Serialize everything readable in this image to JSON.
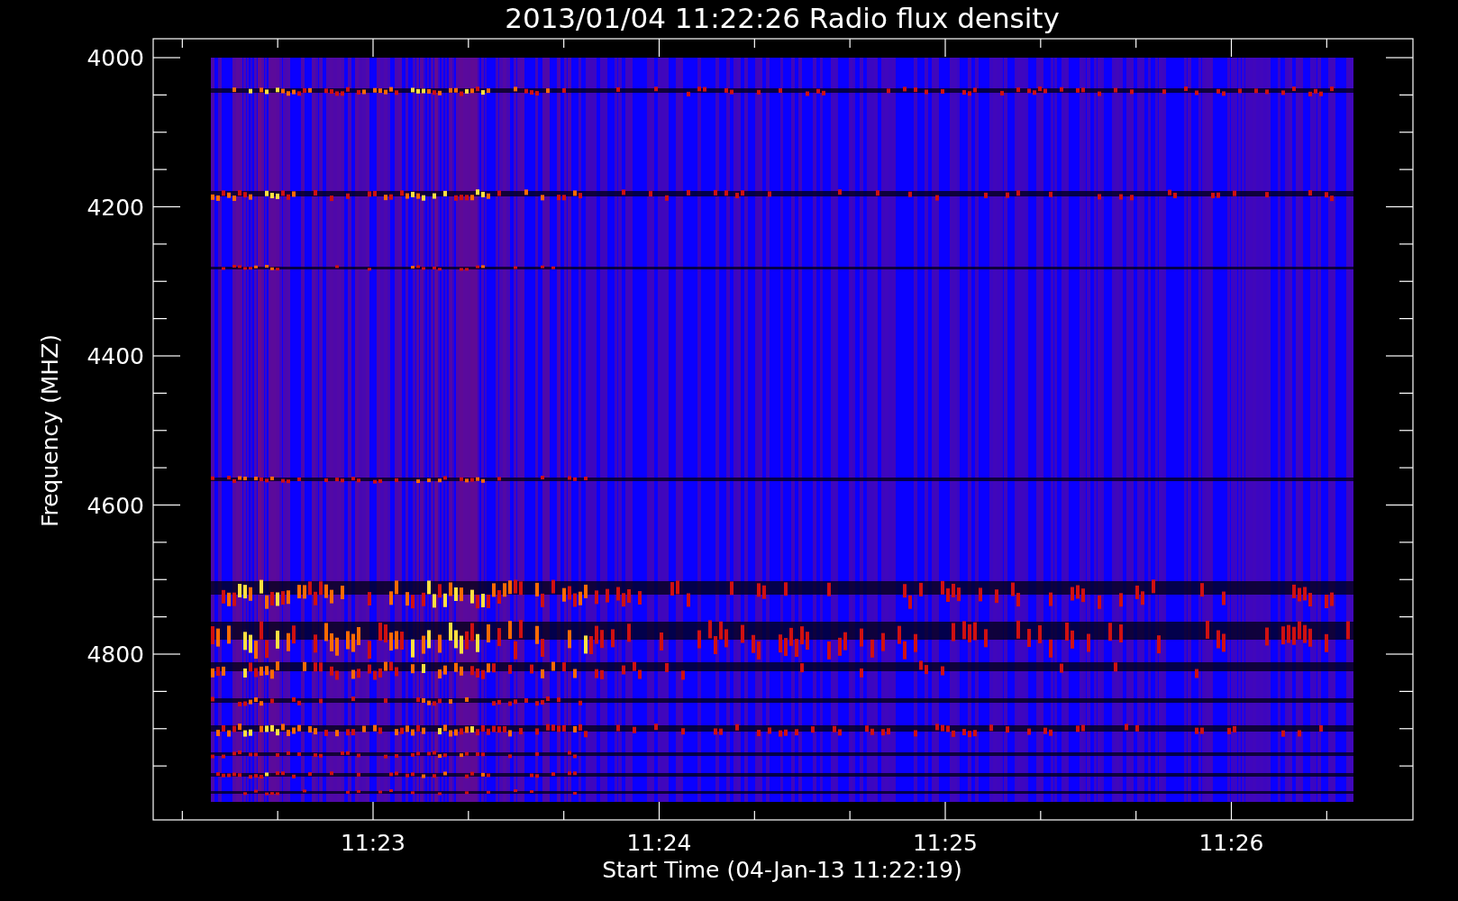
{
  "title": "2013/01/04 11:22:26 Radio flux density",
  "y_axis": {
    "label": "Frequency (MHZ)",
    "ticks": [
      "4000",
      "4200",
      "4400",
      "4600",
      "4800"
    ]
  },
  "x_axis": {
    "label": "Start Time (04-Jan-13 11:22:19)",
    "ticks": [
      "11:23",
      "11:24",
      "11:25",
      "11:26"
    ]
  }
}
